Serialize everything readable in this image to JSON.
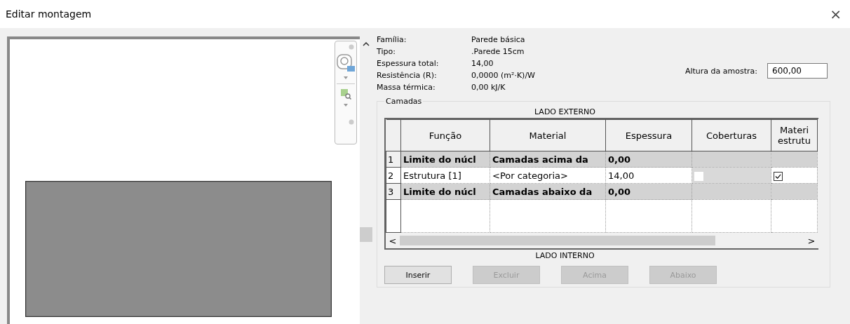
{
  "window": {
    "title": "Editar montagem",
    "close": "×"
  },
  "properties": [
    {
      "label": "Família:",
      "value": "Parede básica"
    },
    {
      "label": "Tipo:",
      "value": ".Parede 15cm"
    },
    {
      "label": "Espessura total:",
      "value": "14,00"
    },
    {
      "label": "Resistência (R):",
      "value": "0,0000 (m²·K)/W"
    },
    {
      "label": "Massa térmica:",
      "value": "0,00 kJ/K"
    }
  ],
  "sample_height": {
    "label": "Altura da amostra:",
    "value": "600,00"
  },
  "layers": {
    "title": "Camadas",
    "top_label": "LADO EXTERNO",
    "bottom_label": "LADO INTERNO",
    "columns": [
      "Função",
      "Material",
      "Espessura",
      "Coberturas",
      "Materi estrutu"
    ],
    "rows": [
      {
        "kind": "boundary",
        "number": "1",
        "function": "Limite do núcl",
        "material": "Camadas acima da",
        "thickness": "0,00"
      },
      {
        "kind": "layer",
        "number": "2",
        "function": "Estrutura [1]",
        "material": "<Por categoria>",
        "thickness": "14,00",
        "wraps": false,
        "structural": true
      },
      {
        "kind": "boundary",
        "number": "3",
        "function": "Limite do núcl",
        "material": "Camadas abaixo da",
        "thickness": "0,00"
      }
    ],
    "scroll_left": "<",
    "scroll_right": ">"
  },
  "buttons": [
    {
      "label": "Inserir",
      "disabled": false
    },
    {
      "label": "Excluir",
      "disabled": true
    },
    {
      "label": "Acima",
      "disabled": true
    },
    {
      "label": "Abaixo",
      "disabled": true
    }
  ]
}
